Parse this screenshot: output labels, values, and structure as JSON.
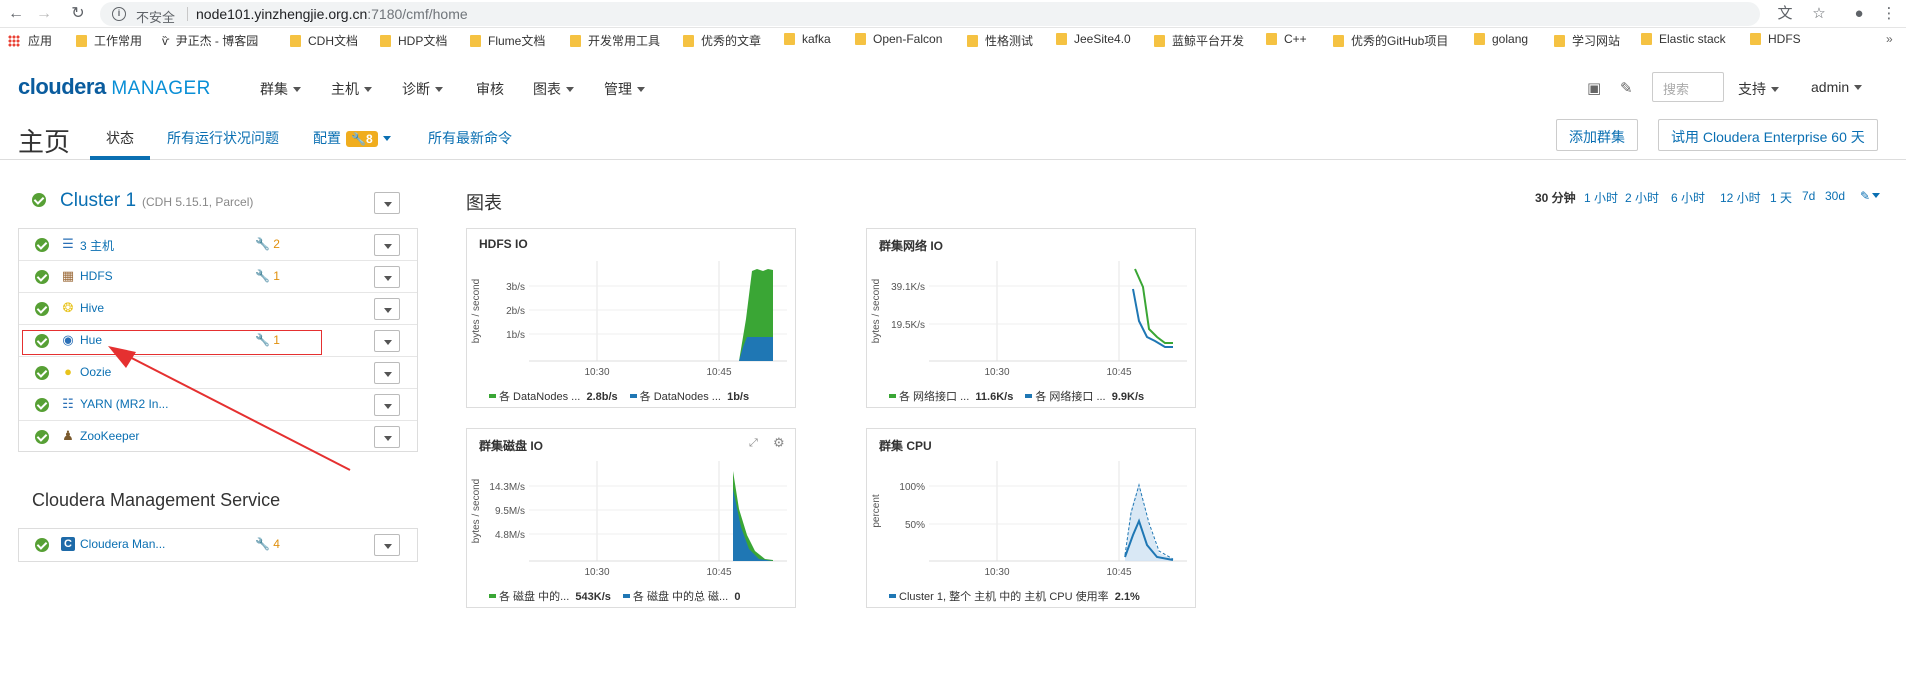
{
  "browser": {
    "insecure_label": "不安全",
    "url_host": "node101.yinzhengjie.org.cn",
    "url_path": ":7180/cmf/home",
    "bookmarks": [
      "应用",
      "工作常用",
      "尹正杰 - 博客园",
      "CDH文档",
      "HDP文档",
      "Flume文档",
      "开发常用工具",
      "优秀的文章",
      "kafka",
      "Open-Falcon",
      "性格测试",
      "JeeSite4.0",
      "蓝鲸平台开发",
      "C++",
      "优秀的GitHub项目",
      "golang",
      "学习网站",
      "Elastic stack",
      "HDFS"
    ]
  },
  "header": {
    "logo_part1": "cloudera",
    "logo_part2": "MANAGER",
    "nav": [
      "群集",
      "主机",
      "诊断",
      "审核",
      "图表",
      "管理"
    ],
    "search_placeholder": "搜索",
    "support": "支持",
    "user": "admin"
  },
  "subheader": {
    "title": "主页",
    "tabs": [
      "状态",
      "所有运行状况问题",
      "配置",
      "所有最新命令"
    ],
    "config_badge": "8",
    "add_cluster": "添加群集",
    "trial": "试用 Cloudera Enterprise 60 天"
  },
  "cluster": {
    "name": "Cluster 1",
    "version": "(CDH 5.15.1, Parcel)",
    "services": [
      {
        "name": "3 主机",
        "config_issues": "2",
        "icon": "list-icon",
        "icon_color": "#2a6fb6"
      },
      {
        "name": "HDFS",
        "config_issues": "1",
        "icon": "hdfs-icon",
        "icon_color": "#9c6b3a"
      },
      {
        "name": "Hive",
        "config_issues": "",
        "icon": "hive-icon",
        "icon_color": "#e8c31c"
      },
      {
        "name": "Hue",
        "config_issues": "1",
        "icon": "hue-icon",
        "icon_color": "#2a6fb6"
      },
      {
        "name": "Oozie",
        "config_issues": "",
        "icon": "oozie-icon",
        "icon_color": "#e8c31c"
      },
      {
        "name": "YARN (MR2 In...",
        "config_issues": "",
        "icon": "yarn-icon",
        "icon_color": "#2a6fb6"
      },
      {
        "name": "ZooKeeper",
        "config_issues": "",
        "icon": "zookeeper-icon",
        "icon_color": "#7a5a2e"
      }
    ]
  },
  "mgmt": {
    "title": "Cloudera Management Service",
    "service_name": "Cloudera Man...",
    "config_issues": "4"
  },
  "charts_title": "图表",
  "time_ranges": [
    "30 分钟",
    "1 小时",
    "2 小时",
    "6 小时",
    "12 小时",
    "1 天",
    "7d",
    "30d"
  ],
  "colors": {
    "green": "#3aa635",
    "blue": "#1f77b4",
    "brand": "#0a6fb2",
    "warning": "#e0900e"
  },
  "chart_data": [
    {
      "type": "area",
      "title": "HDFS IO",
      "ylabel": "bytes / second",
      "y_ticks": [
        "3b/s",
        "2b/s",
        "1b/s"
      ],
      "x_ticks": [
        "10:30",
        "10:45"
      ],
      "series": [
        {
          "name": "各 DataNodes ...",
          "value": "2.8b/s",
          "color": "#3aa635"
        },
        {
          "name": "各 DataNodes ...",
          "value": "1b/s",
          "color": "#1f77b4"
        }
      ]
    },
    {
      "type": "line",
      "title": "群集网络 IO",
      "ylabel": "bytes / second",
      "y_ticks": [
        "39.1K/s",
        "19.5K/s"
      ],
      "x_ticks": [
        "10:30",
        "10:45"
      ],
      "series": [
        {
          "name": "各 网络接口 ...",
          "value": "11.6K/s",
          "color": "#3aa635"
        },
        {
          "name": "各 网络接口 ...",
          "value": "9.9K/s",
          "color": "#1f77b4"
        }
      ]
    },
    {
      "type": "area",
      "title": "群集磁盘 IO",
      "ylabel": "bytes / second",
      "y_ticks": [
        "14.3M/s",
        "9.5M/s",
        "4.8M/s"
      ],
      "x_ticks": [
        "10:30",
        "10:45"
      ],
      "series": [
        {
          "name": "各 磁盘 中的...",
          "value": "543K/s",
          "color": "#3aa635"
        },
        {
          "name": "各 磁盘 中的总 磁...",
          "value": "0",
          "color": "#1f77b4"
        }
      ]
    },
    {
      "type": "line",
      "title": "群集 CPU",
      "ylabel": "percent",
      "y_ticks": [
        "100%",
        "50%"
      ],
      "x_ticks": [
        "10:30",
        "10:45"
      ],
      "series": [
        {
          "name": "Cluster 1, 整个 主机 中的 主机 CPU 使用率",
          "value": "2.1%",
          "color": "#1f77b4"
        }
      ]
    }
  ]
}
